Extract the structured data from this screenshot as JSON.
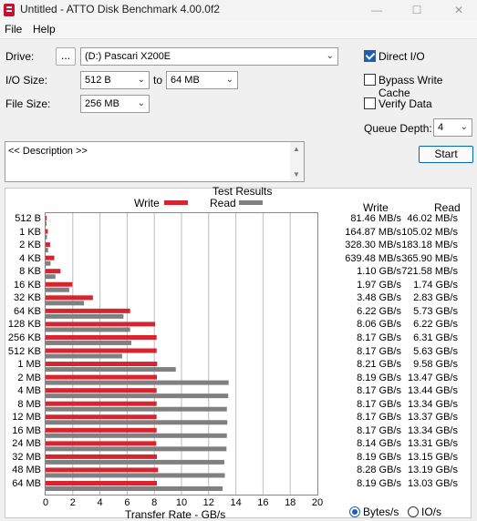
{
  "window": {
    "title": "Untitled - ATTO Disk Benchmark 4.00.0f2",
    "min": "—",
    "max": "☐",
    "close": "✕"
  },
  "menu": {
    "file": "File",
    "help": "Help"
  },
  "form": {
    "drive_label": "Drive:",
    "browse_label": "...",
    "drive_value": "(D:) Pascari X200E",
    "io_label": "I/O Size:",
    "io_from": "512 B",
    "io_to_label": "to",
    "io_to": "64 MB",
    "file_label": "File Size:",
    "file_value": "256 MB",
    "direct_io": "Direct I/O",
    "bypass_cache": "Bypass Write Cache",
    "verify": "Verify Data",
    "queue_label": "Queue Depth:",
    "queue_value": "4",
    "start": "Start",
    "description": "<< Description >>"
  },
  "results": {
    "title": "Test Results",
    "legend_write": "Write",
    "legend_read": "Read",
    "col_write": "Write",
    "col_read": "Read",
    "xlabel": "Transfer Rate - GB/s",
    "xticks": [
      "0",
      "2",
      "4",
      "6",
      "8",
      "10",
      "12",
      "14",
      "16",
      "18",
      "20"
    ],
    "unit_bytes": "Bytes/s",
    "unit_io": "IO/s"
  },
  "colors": {
    "write": "#d8242f",
    "read": "#808080"
  },
  "chart_data": {
    "type": "bar",
    "title": "Test Results",
    "xlabel": "Transfer Rate - GB/s",
    "xlim": [
      0,
      20
    ],
    "categories": [
      "512 B",
      "1 KB",
      "2 KB",
      "4 KB",
      "8 KB",
      "16 KB",
      "32 KB",
      "64 KB",
      "128 KB",
      "256 KB",
      "512 KB",
      "1 MB",
      "2 MB",
      "4 MB",
      "8 MB",
      "12 MB",
      "16 MB",
      "24 MB",
      "32 MB",
      "48 MB",
      "64 MB"
    ],
    "series": [
      {
        "name": "Write",
        "values": [
          0.0815,
          0.1649,
          0.3283,
          0.6395,
          1.1,
          1.97,
          3.48,
          6.22,
          8.06,
          8.17,
          8.17,
          8.21,
          8.19,
          8.17,
          8.17,
          8.17,
          8.17,
          8.14,
          8.19,
          8.28,
          8.19
        ],
        "labels": [
          "81.46 MB/s",
          "164.87 MB/s",
          "328.30 MB/s",
          "639.48 MB/s",
          "1.10 GB/s",
          "1.97 GB/s",
          "3.48 GB/s",
          "6.22 GB/s",
          "8.06 GB/s",
          "8.17 GB/s",
          "8.17 GB/s",
          "8.21 GB/s",
          "8.19 GB/s",
          "8.17 GB/s",
          "8.17 GB/s",
          "8.17 GB/s",
          "8.17 GB/s",
          "8.14 GB/s",
          "8.19 GB/s",
          "8.28 GB/s",
          "8.19 GB/s"
        ]
      },
      {
        "name": "Read",
        "values": [
          0.046,
          0.105,
          0.1832,
          0.3659,
          0.7216,
          1.74,
          2.83,
          5.73,
          6.22,
          6.31,
          5.63,
          9.58,
          13.47,
          13.44,
          13.34,
          13.37,
          13.34,
          13.31,
          13.15,
          13.19,
          13.03
        ],
        "labels": [
          "46.02 MB/s",
          "105.02 MB/s",
          "183.18 MB/s",
          "365.90 MB/s",
          "721.58 MB/s",
          "1.74 GB/s",
          "2.83 GB/s",
          "5.73 GB/s",
          "6.22 GB/s",
          "6.31 GB/s",
          "5.63 GB/s",
          "9.58 GB/s",
          "13.47 GB/s",
          "13.44 GB/s",
          "13.34 GB/s",
          "13.37 GB/s",
          "13.34 GB/s",
          "13.31 GB/s",
          "13.15 GB/s",
          "13.19 GB/s",
          "13.03 GB/s"
        ]
      }
    ],
    "grid": true
  }
}
